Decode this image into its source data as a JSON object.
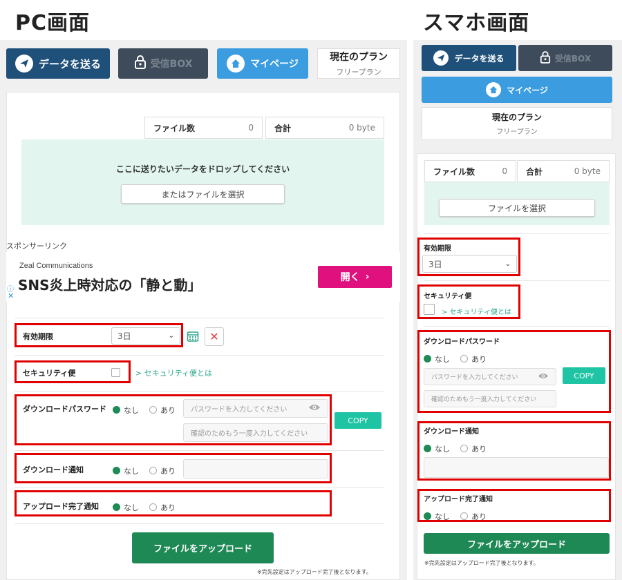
{
  "headings": {
    "pc": "PC画面",
    "mobile": "スマホ画面"
  },
  "nav": {
    "send": "データを送る",
    "box": "受信BOX",
    "mypage": "マイページ",
    "plan_title": "現在のプラン",
    "plan_name": "フリープラン"
  },
  "file_counter": {
    "count_label": "ファイル数",
    "count_value": "0",
    "total_label": "合計",
    "total_value": "0 byte"
  },
  "drop": {
    "prompt": "ここに送りたいデータをドロップしてください",
    "select_pc": "またはファイルを選択",
    "select_mobile": "ファイルを選択"
  },
  "ad": {
    "sponsor": "スポンサーリンク",
    "advertiser": "Zeal Communications",
    "headline": "SNS炎上時対応の「静と動」",
    "cta": "開く"
  },
  "expiry": {
    "label": "有効期限",
    "value": "3日"
  },
  "security": {
    "label": "セキュリティ便",
    "link": "> セキュリティ便とは"
  },
  "password": {
    "label": "ダウンロードパスワード",
    "opt_none": "なし",
    "opt_yes": "あり",
    "placeholder": "パスワードを入力してください",
    "confirm_placeholder": "確認のためもう一度入力してください",
    "copy": "COPY"
  },
  "dl_notify": {
    "label": "ダウンロード通知",
    "opt_none": "なし",
    "opt_yes": "あり"
  },
  "up_notify": {
    "label": "アップロード完了通知",
    "opt_none": "なし",
    "opt_yes": "あり"
  },
  "upload": {
    "button": "ファイルをアップロード",
    "note": "※完先設定はアップロード完了後となります。"
  },
  "colors": {
    "primary": "#1f5079",
    "accent_blue": "#3b9ce0",
    "upload_green": "#1f8956",
    "highlight_red": "#e00000",
    "ad_pink": "#e0117f"
  }
}
